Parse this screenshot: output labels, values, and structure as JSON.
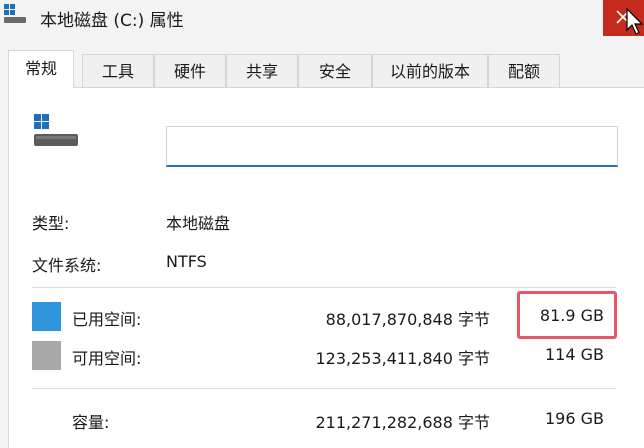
{
  "window": {
    "title": "本地磁盘 (C:) 属性",
    "icon": "windows-drive-icon"
  },
  "tabs": [
    {
      "label": "常规",
      "active": true
    },
    {
      "label": "工具",
      "active": false
    },
    {
      "label": "硬件",
      "active": false
    },
    {
      "label": "共享",
      "active": false
    },
    {
      "label": "安全",
      "active": false
    },
    {
      "label": "以前的版本",
      "active": false
    },
    {
      "label": "配额",
      "active": false
    }
  ],
  "general": {
    "drive_icon": "hard-drive-icon",
    "name_value": "",
    "type_label": "类型:",
    "type_value": "本地磁盘",
    "fs_label": "文件系统:",
    "fs_value": "NTFS",
    "used": {
      "label": "已用空间:",
      "bytes": "88,017,870,848 字节",
      "size": "81.9 GB",
      "color": "#2f95dc"
    },
    "free": {
      "label": "可用空间:",
      "bytes": "123,253,411,840 字节",
      "size": "114 GB",
      "color": "#a8a8a8"
    },
    "capacity": {
      "label": "容量:",
      "bytes": "211,271,282,688 字节",
      "size": "196 GB"
    }
  },
  "colors": {
    "accent": "#1f6fb6",
    "close": "#c42b1c",
    "highlight": "#e8566a"
  }
}
